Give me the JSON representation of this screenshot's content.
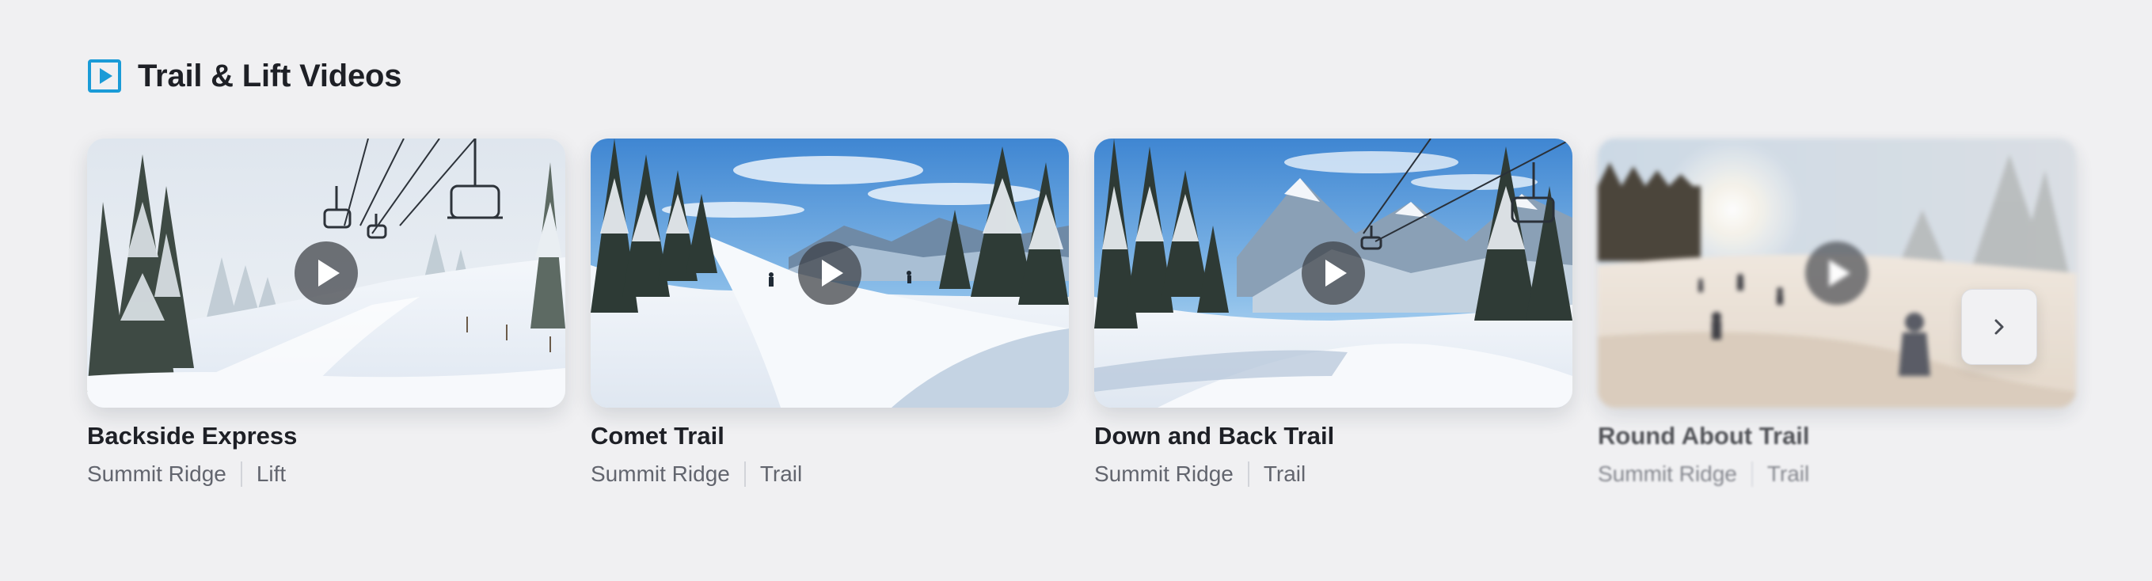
{
  "section": {
    "title": "Trail & Lift Videos",
    "icon": "video-play-icon",
    "accent_color": "#1a9bd7"
  },
  "videos": [
    {
      "title": "Backside Express",
      "resort": "Summit Ridge",
      "type": "Lift"
    },
    {
      "title": "Comet Trail",
      "resort": "Summit Ridge",
      "type": "Trail"
    },
    {
      "title": "Down and Back Trail",
      "resort": "Summit Ridge",
      "type": "Trail"
    },
    {
      "title": "Round About Trail",
      "resort": "Summit Ridge",
      "type": "Trail"
    }
  ],
  "controls": {
    "next_icon": "chevron-right-icon",
    "play_icon": "play-icon"
  }
}
